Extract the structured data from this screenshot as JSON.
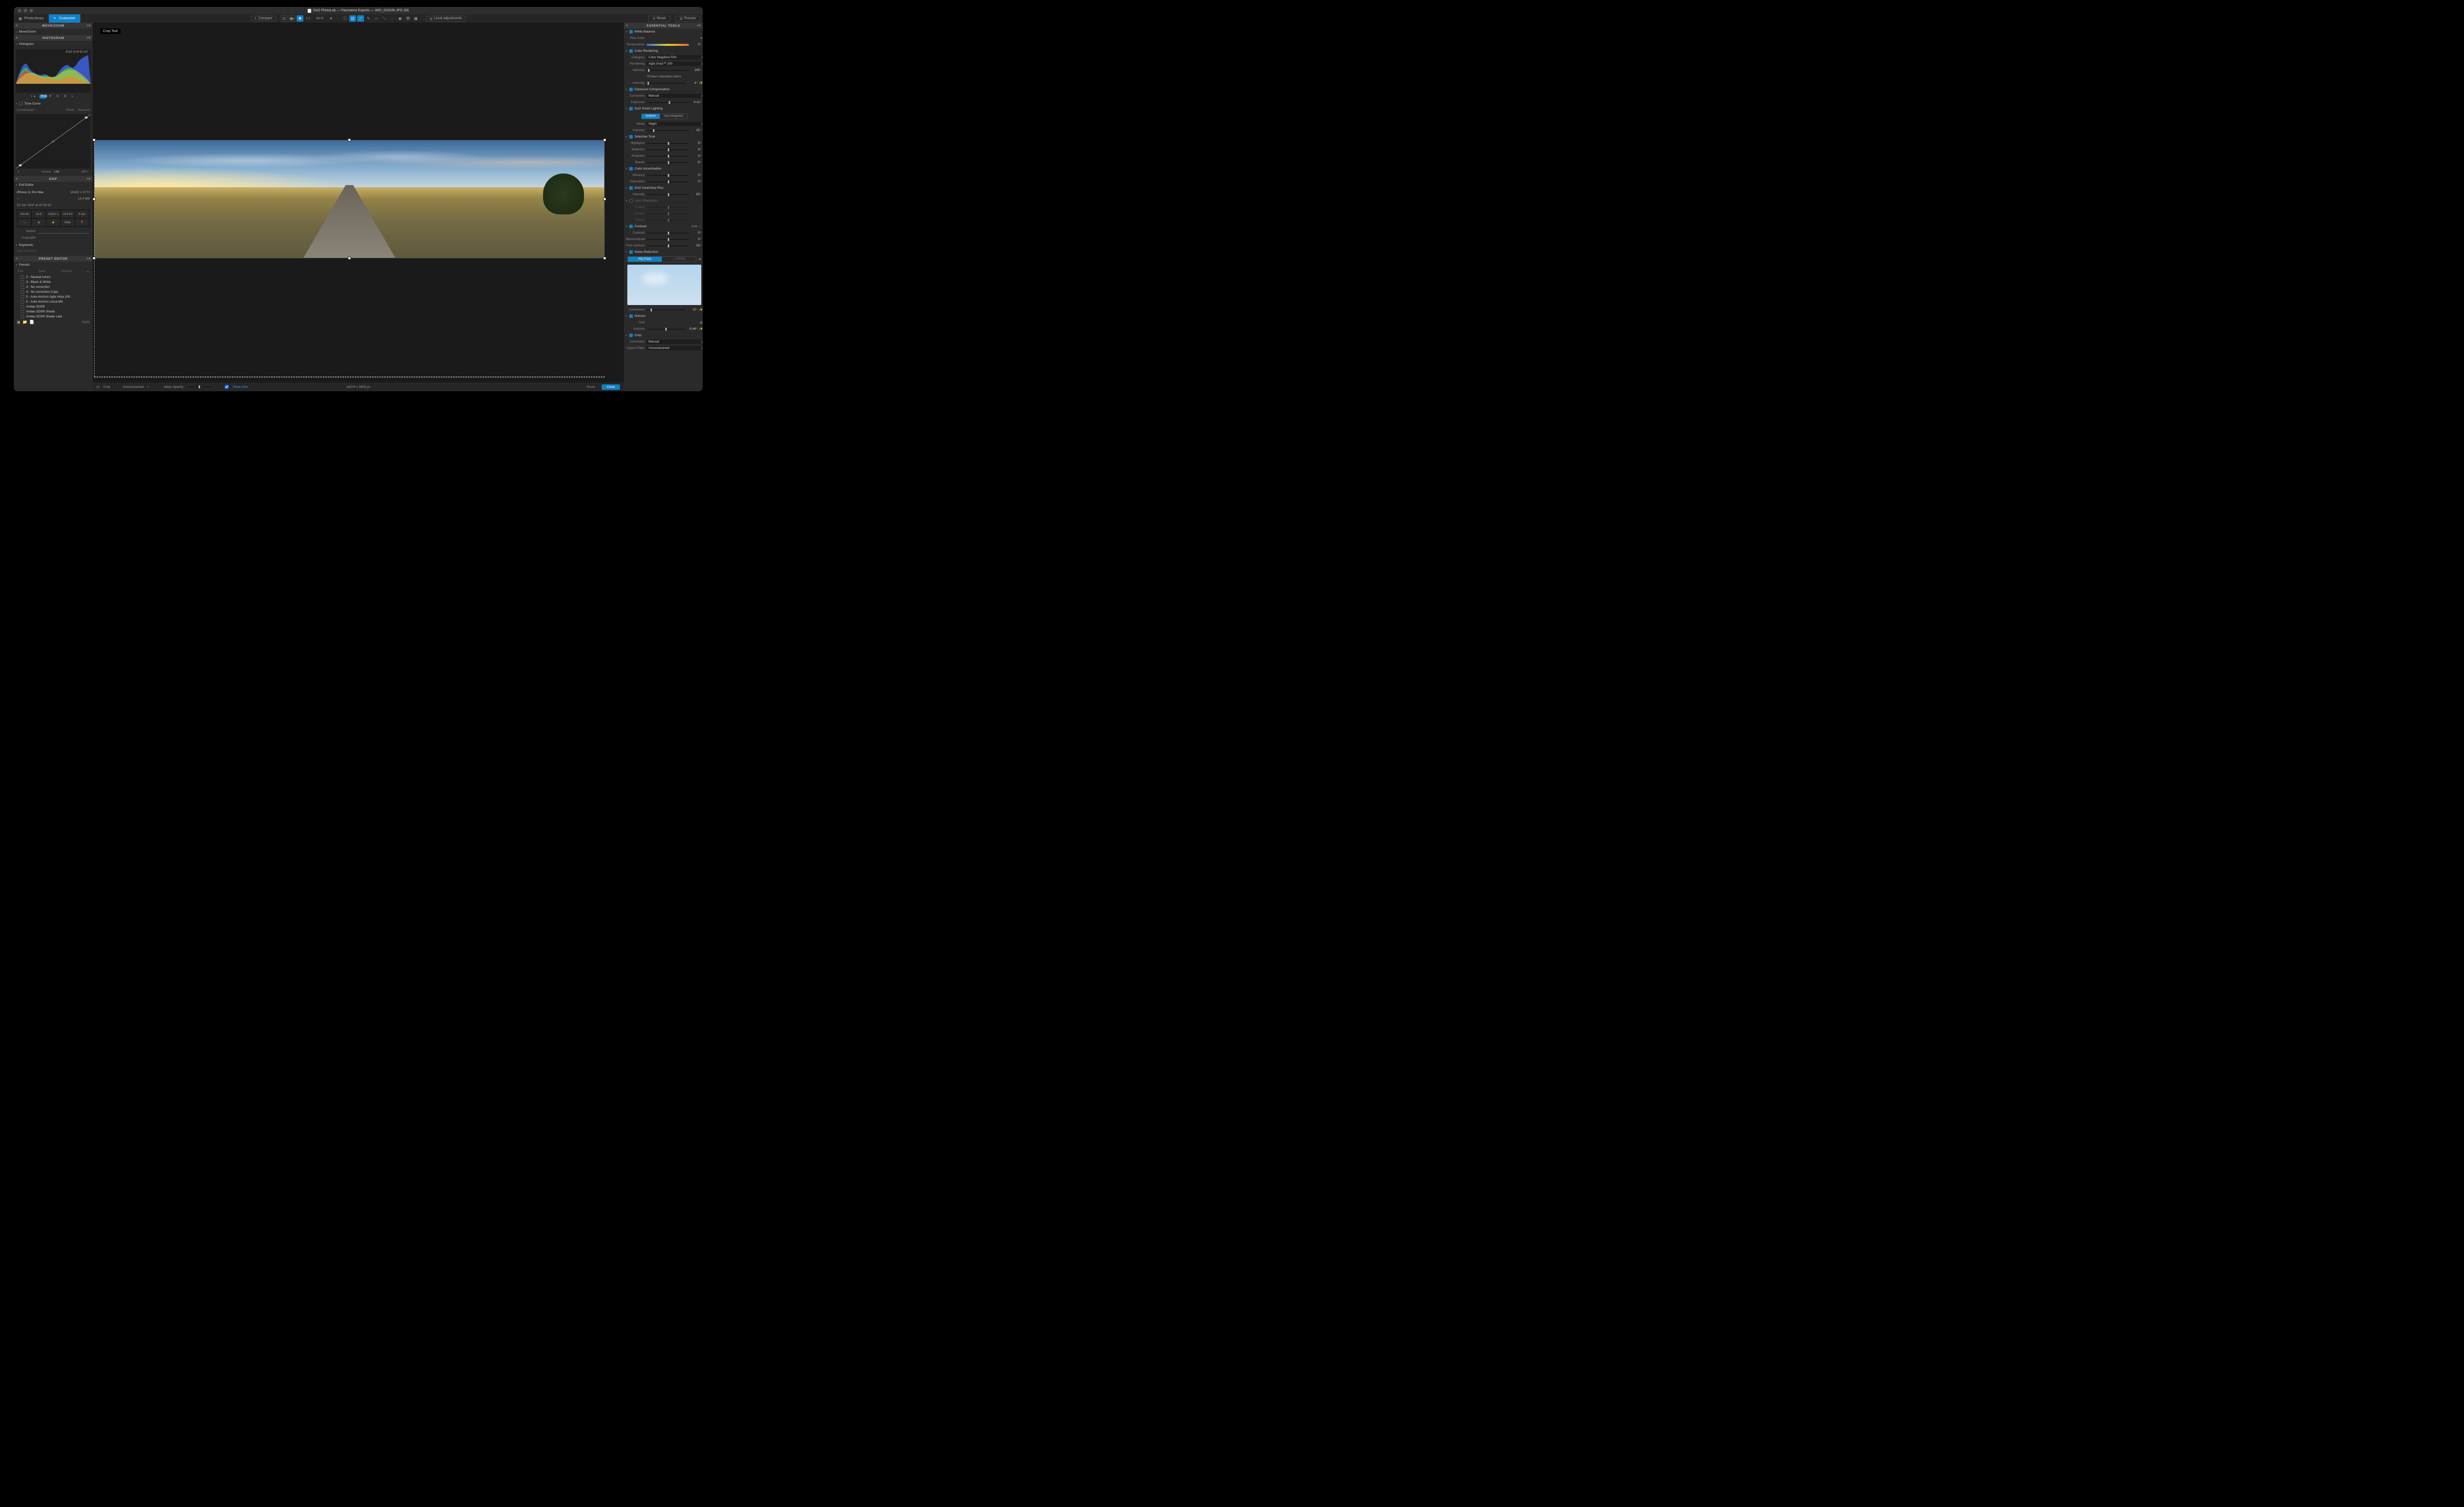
{
  "title": "DxO PhotoLab — Panorama Exports — IMG_002535.JPG (M)",
  "modebar": {
    "photolibrary": "PhotoLibrary",
    "customize": "Customize",
    "compare": "Compare",
    "one_to_one": "1:1",
    "zoom": "24 %",
    "local_adjustments": "Local adjustments",
    "reset": "Reset",
    "presets": "Presets"
  },
  "tooltip": "Crop Tool",
  "left": {
    "movezoom": {
      "head": "MOVE/ZOOM",
      "row": "Move/Zoom"
    },
    "histogram": {
      "head": "HISTOGRAM",
      "row": "Histogram",
      "readout": "R:82 G:94 B:110",
      "tabs": [
        "RGB",
        "R",
        "G",
        "B",
        "L"
      ]
    },
    "tonecurve": {
      "row": "Tone Curve",
      "curve_label": "Curve",
      "master": "Master",
      "reset": "Reset",
      "reset_all": "Reset All",
      "y_max": "255",
      "y_min": "0",
      "x_min": "0",
      "gamma_label": "Gamma",
      "gamma_val": "1.00",
      "x_max": "255"
    },
    "exif": {
      "head": "EXIF",
      "row": "Exif Editor",
      "camera": "iPhone 11 Pro Max",
      "dimensions": "16382 x 3770",
      "lens": "—",
      "filesize": "19.4 MB",
      "date": "22 Jun 2020 at 20:32:32",
      "iso": "ISO 40",
      "aperture": "f/1.8",
      "shutter": "1/1007 s",
      "ev": "+0.0 EV",
      "focal": "4 mm",
      "wb_icon": "—",
      "pattern": "⊞",
      "flash": "⚡",
      "colorspace": "RGB",
      "gps": "📍",
      "author_label": "Author",
      "copyright_label": "Copyright",
      "keywords_row": "Keywords",
      "keywords_placeholder": "Add keywords"
    },
    "preset": {
      "head": "PRESET EDITOR",
      "row": "Presets",
      "edit": "Edit",
      "save": "Save",
      "discard": "Discard",
      "items": [
        "2 - Neutral colors",
        "3 - Black & White",
        "4 - No correction",
        "4 - No correction Copy",
        "5 - Auto-horizon Agfa Vista 200",
        "5 - Auto-horizon Leica M9",
        "Andau 5DSR",
        "Andau 5DSR Shade",
        "Andau 5DSR Shade Late"
      ],
      "apply": "Apply"
    }
  },
  "right": {
    "head": "ESSENTIAL TOOLS",
    "wb": {
      "name": "White Balance",
      "pick": "Pick Color",
      "temp_label": "Temperature",
      "temp_val": "0"
    },
    "color_rendering": {
      "name": "Color Rendering",
      "cat_label": "Category",
      "cat_val": "Color Negative Film",
      "ren_label": "Rendering",
      "ren_val": "Agfa Vista™ 200",
      "int_label": "Intensity",
      "int_val": "100",
      "protect": "Protect saturated colors",
      "protect_int_label": "Intensity",
      "protect_int_val": "4"
    },
    "exposure": {
      "name": "Exposure Compensation",
      "corr_label": "Correction",
      "corr_val": "Manual",
      "exp_label": "Exposure",
      "exp_val": "0.11"
    },
    "smart_lighting": {
      "name": "DxO Smart Lighting",
      "uniform": "Uniform",
      "spot": "Spot Weighted",
      "mode_label": "Mode",
      "mode_val": "Slight",
      "int_label": "Intensity",
      "int_val": "25"
    },
    "selective_tone": {
      "name": "Selective Tone",
      "rows": [
        {
          "label": "Highlights",
          "val": "8"
        },
        {
          "label": "Midtones",
          "val": "6"
        },
        {
          "label": "Shadows",
          "val": "3"
        },
        {
          "label": "Blacks",
          "val": "-5"
        }
      ]
    },
    "color_accent": {
      "name": "Color Accentuation",
      "rows": [
        {
          "label": "Vibrancy",
          "val": "0"
        },
        {
          "label": "Saturation",
          "val": "0"
        }
      ]
    },
    "clearview": {
      "name": "DxO ClearView Plus",
      "int_label": "Intensity",
      "int_val": "50"
    },
    "lens_sharpness": {
      "name": "Lens Sharpness",
      "rows": [
        {
          "label": "Global",
          "val": ""
        },
        {
          "label": "Details",
          "val": ""
        },
        {
          "label": "Bokeh",
          "val": ""
        }
      ]
    },
    "contrast": {
      "name": "Contrast",
      "auto": "Auto",
      "rows": [
        {
          "label": "Contrast",
          "val": "0"
        },
        {
          "label": "Microcontrast",
          "val": "0"
        },
        {
          "label": "Fine contrast",
          "val": "33"
        }
      ]
    },
    "noise": {
      "name": "Noise Reduction",
      "hq": "HQ (Fast)",
      "prime": "PRIME",
      "lum_label": "Luminance",
      "lum_val": "12"
    },
    "horizon": {
      "name": "Horizon",
      "tool_label": "Tool",
      "hor_label": "Horizon",
      "hor_val": "-0.46"
    },
    "crop": {
      "name": "Crop",
      "corr_label": "Correction",
      "corr_val": "Manual",
      "ar_label": "Aspect Ratio",
      "ar_val": "Unconstrained"
    }
  },
  "bottombar": {
    "crop": "Crop",
    "mode": "Unconstrained",
    "mask": "Mask Opacity",
    "showgrid": "Show Grid",
    "dims": "16274 x 3605 px",
    "reset": "Reset",
    "close": "Close"
  }
}
